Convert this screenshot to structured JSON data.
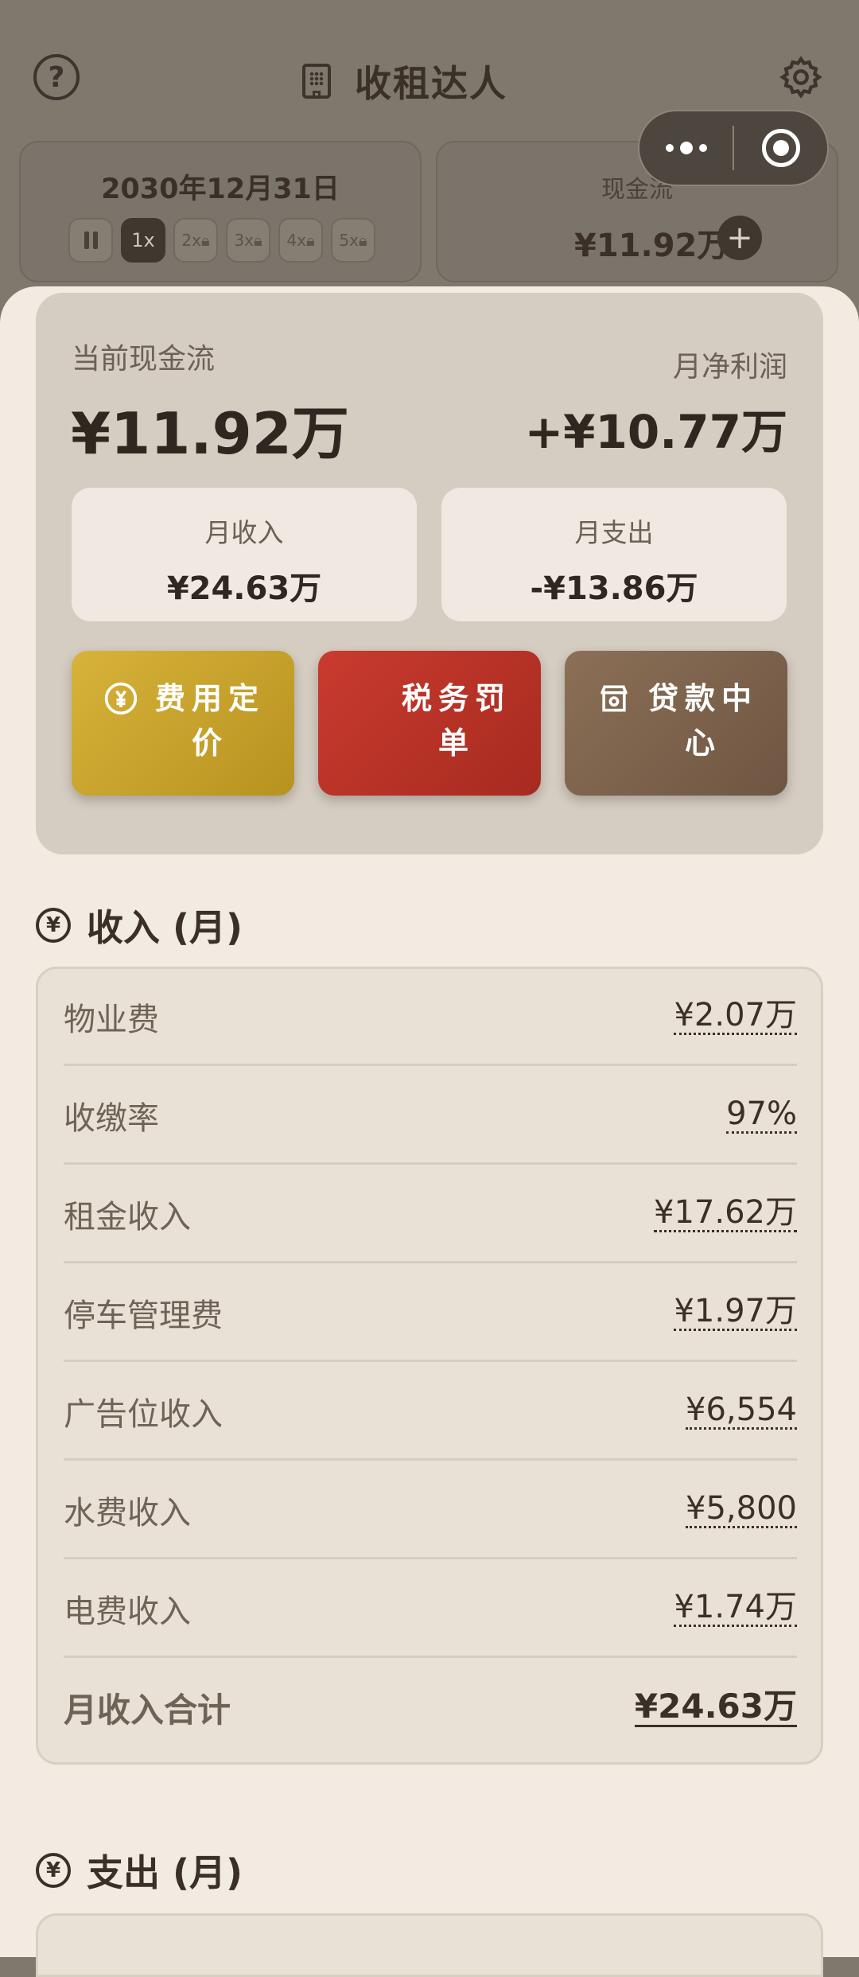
{
  "header": {
    "title": "收租达人",
    "date": "2030年12月31日",
    "speeds": [
      "1x",
      "2x",
      "3x",
      "4x",
      "5x"
    ],
    "cash_label": "现金流",
    "cash_value": "¥11.92万",
    "plus": "+"
  },
  "summary": {
    "current_label": "当前现金流",
    "current_value": "¥11.92万",
    "profit_label": "月净利润",
    "profit_value": "+¥10.77万",
    "income_label": "月收入",
    "income_value": "¥24.63万",
    "expense_label": "月支出",
    "expense_value": "-¥13.86万"
  },
  "actions": {
    "fee": "费用定价",
    "tax": "税务罚单",
    "loan": "贷款中心"
  },
  "income": {
    "title": "收入 (月)",
    "rows": [
      {
        "label": "物业费",
        "value": "¥2.07万"
      },
      {
        "label": "收缴率",
        "value": "97%"
      },
      {
        "label": "租金收入",
        "value": "¥17.62万"
      },
      {
        "label": "停车管理费",
        "value": "¥1.97万"
      },
      {
        "label": "广告位收入",
        "value": "¥6,554"
      },
      {
        "label": "水费收入",
        "value": "¥5,800"
      },
      {
        "label": "电费收入",
        "value": "¥1.74万"
      }
    ],
    "total_label": "月收入合计",
    "total_value": "¥24.63万"
  },
  "expense": {
    "title": "支出 (月)"
  },
  "icons": [
    "help-icon",
    "building-icon",
    "gear-icon",
    "more-icon",
    "target-icon",
    "pause-icon",
    "lock-icon",
    "yen-icon",
    "store-icon"
  ]
}
